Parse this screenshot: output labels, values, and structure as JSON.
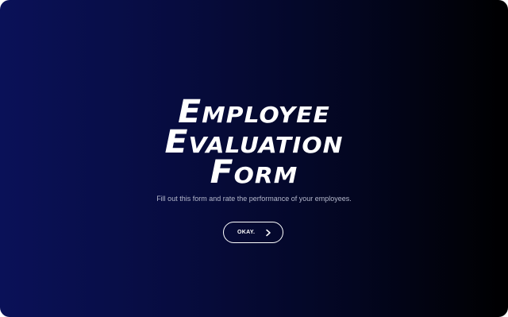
{
  "form": {
    "title_line1": "Employee",
    "title_line2": "Evaluation",
    "title_line3": "Form",
    "description": "Fill out this form and rate the performance of your employees.",
    "start_button_label": "OKAY.",
    "start_button_icon": "chevron-right-icon"
  },
  "colors": {
    "background_start": "#0a1158",
    "background_end": "#000000",
    "text": "#ffffff",
    "description_text": "#b4b8cc"
  }
}
